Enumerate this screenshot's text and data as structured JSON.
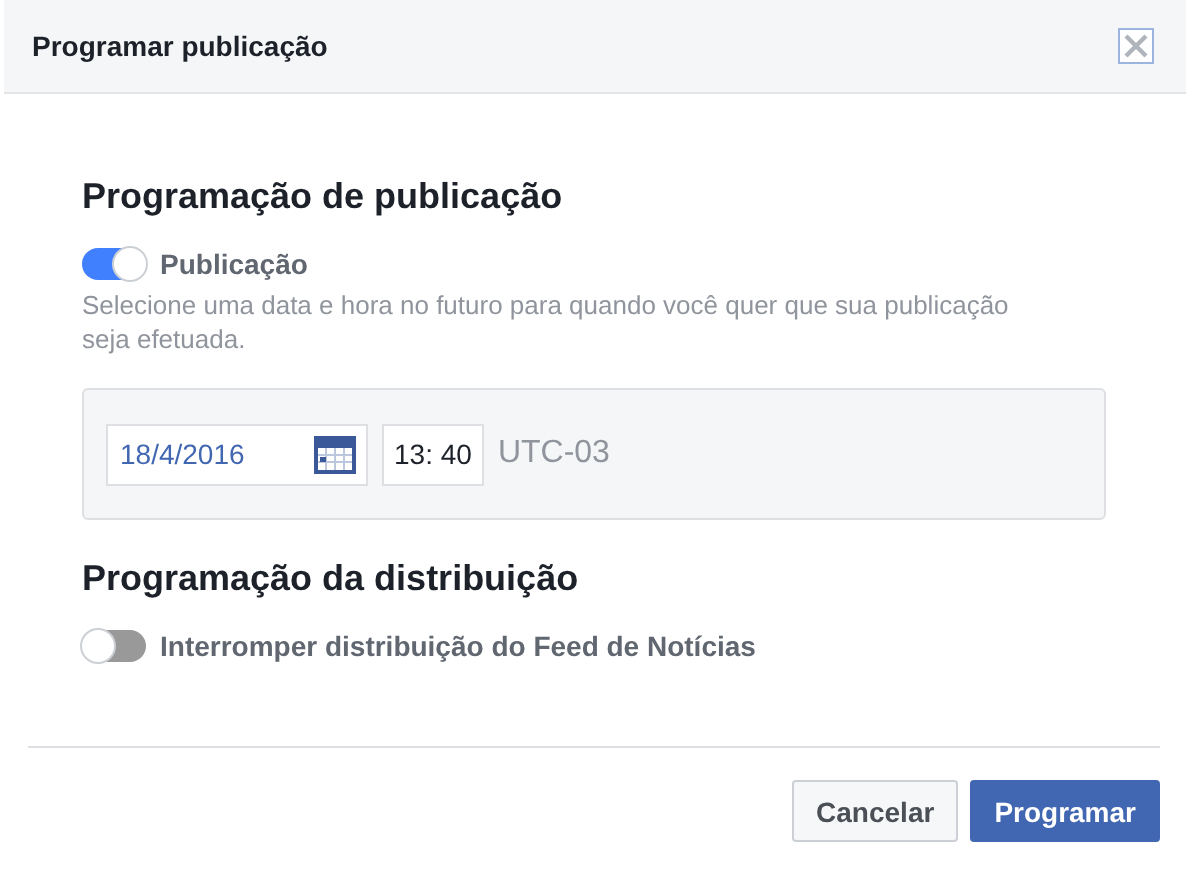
{
  "dialog": {
    "title": "Programar publicação"
  },
  "sections": [
    {
      "heading": "Programação de publicação",
      "toggle": {
        "label": "Publicação",
        "on": true
      },
      "description": "Selecione uma data e hora no futuro para quando você quer que sua publicação seja efetuada.",
      "date": "18/4/2016",
      "time": "13: 40",
      "timezone": "UTC-03"
    },
    {
      "heading": "Programação da distribuição",
      "toggle": {
        "label": "Interromper distribuição do Feed de Notícias",
        "on": false
      }
    }
  ],
  "buttons": [
    {
      "label": "Cancelar",
      "kind": "secondary"
    },
    {
      "label": "Programar",
      "kind": "primary"
    }
  ]
}
